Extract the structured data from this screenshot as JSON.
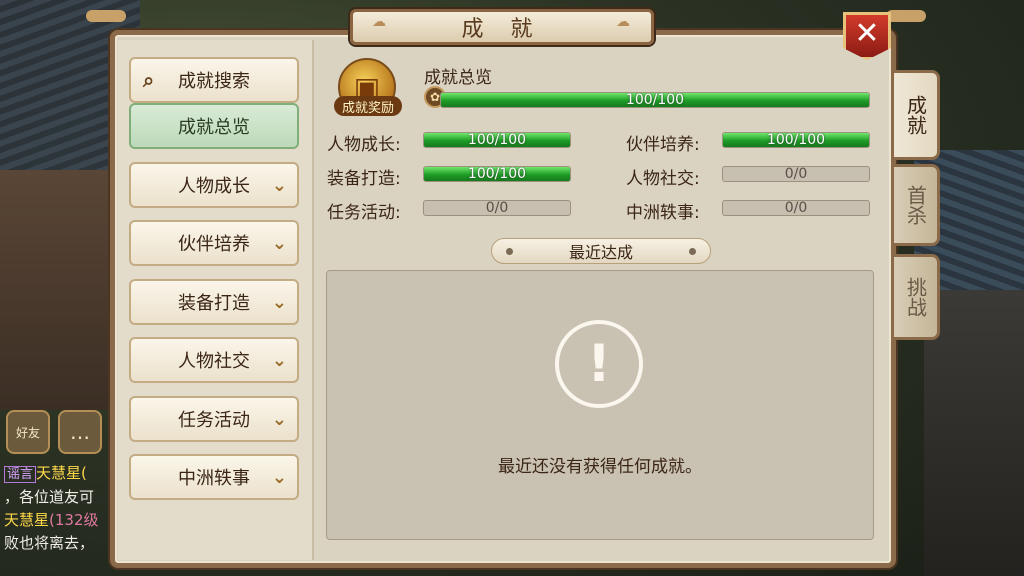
{
  "window": {
    "title": "成 就",
    "close_label": "✕"
  },
  "side_tabs": [
    {
      "label": "成就",
      "active": true
    },
    {
      "label": "首杀",
      "active": false
    },
    {
      "label": "挑战",
      "active": false
    }
  ],
  "menu": {
    "search_label": "成就搜索",
    "items": [
      {
        "label": "成就总览",
        "active": true
      },
      {
        "label": "人物成长",
        "active": false
      },
      {
        "label": "伙伴培养",
        "active": false
      },
      {
        "label": "装备打造",
        "active": false
      },
      {
        "label": "人物社交",
        "active": false
      },
      {
        "label": "任务活动",
        "active": false
      },
      {
        "label": "中洲轶事",
        "active": false
      }
    ]
  },
  "overview": {
    "reward_label": "成就奖励",
    "title": "成就总览",
    "total": {
      "text": "100/100",
      "fraction": 1.0
    },
    "stats": [
      {
        "label": "人物成长:",
        "text": "100/100",
        "fraction": 1.0
      },
      {
        "label": "伙伴培养:",
        "text": "100/100",
        "fraction": 1.0
      },
      {
        "label": "装备打造:",
        "text": "100/100",
        "fraction": 1.0
      },
      {
        "label": "人物社交:",
        "text": "0/0",
        "fraction": 0
      },
      {
        "label": "任务活动:",
        "text": "0/0",
        "fraction": 0
      },
      {
        "label": "中洲轶事:",
        "text": "0/0",
        "fraction": 0
      }
    ]
  },
  "recent": {
    "header": "最近达成",
    "empty_message": "最近还没有获得任何成就。"
  },
  "chat": {
    "icons": [
      "friend-icon",
      "chat-bubble-icon"
    ],
    "friend_label": "好友",
    "lines": [
      {
        "tag": "谣言",
        "name": "天慧星("
      },
      {
        "text": "，各位道友可"
      },
      {
        "name": "天慧星",
        "tag2": "(132级"
      },
      {
        "text": "败也将离去，"
      }
    ]
  },
  "colors": {
    "accent": "#8a6a48",
    "progress": "#1e9c26",
    "close": "#d23b2b"
  }
}
